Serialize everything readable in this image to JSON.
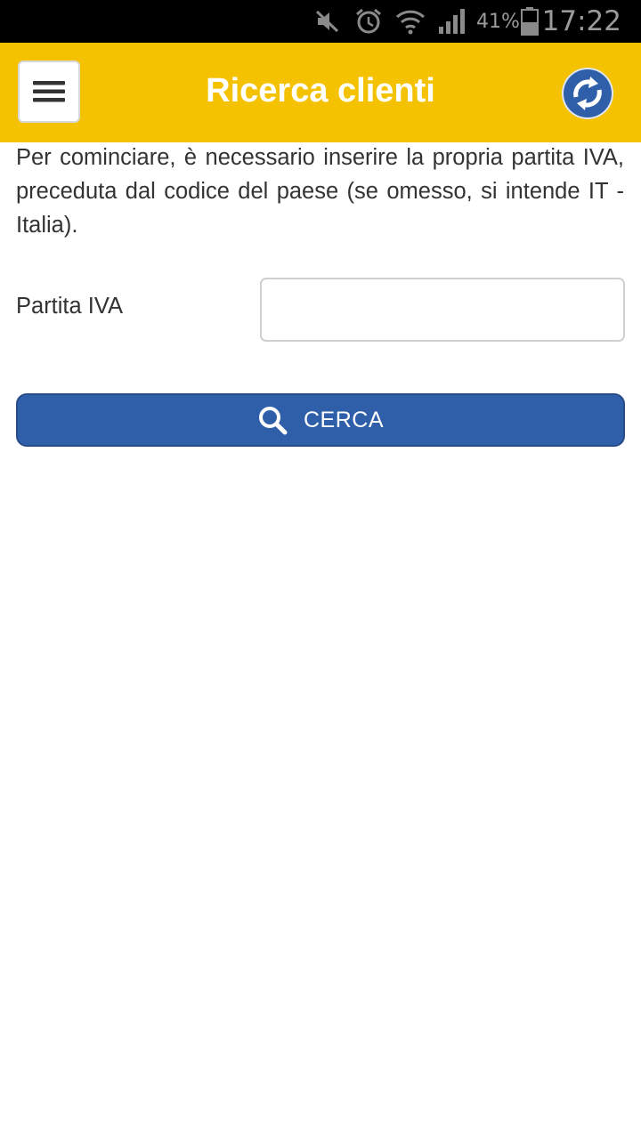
{
  "status_bar": {
    "icons": [
      "mute-icon",
      "alarm-icon",
      "wifi-icon",
      "signal-icon",
      "battery-icon"
    ],
    "battery_percent": "41%",
    "time": "17:22"
  },
  "app_bar": {
    "title": "Ricerca clienti",
    "background_color": "#f4c200",
    "menu_icon": "hamburger-menu-icon",
    "refresh_icon": "refresh-icon"
  },
  "content": {
    "intro_text": "Per cominciare, è necessario inserire la propria partita IVA, preceduta dal codice del paese (se omesso, si intende IT - Italia).",
    "vat_field": {
      "label": "Partita IVA",
      "value": "",
      "placeholder": ""
    },
    "search_button": {
      "label": "CERCA",
      "icon": "search-icon",
      "color": "#2f5fa9"
    }
  }
}
